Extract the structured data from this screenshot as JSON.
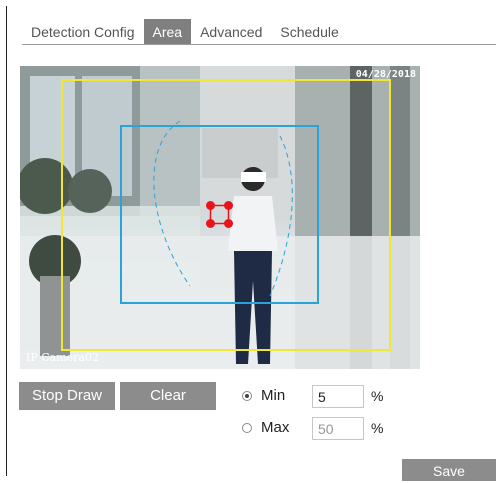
{
  "tabs": [
    {
      "label": "Detection Config",
      "active": false
    },
    {
      "label": "Area",
      "active": true
    },
    {
      "label": "Advanced",
      "active": false
    },
    {
      "label": "Schedule",
      "active": false
    }
  ],
  "video": {
    "timestamp": "04/28/2018",
    "camera_name": "IP Camera02"
  },
  "buttons": {
    "stop_draw": "Stop Draw",
    "clear": "Clear",
    "save": "Save"
  },
  "size": {
    "min_label": "Min",
    "min_value": "5",
    "min_unit": "%",
    "max_label": "Max",
    "max_value": "50",
    "max_unit": "%",
    "selected": "Min"
  },
  "colors": {
    "active_tab": "#7f7f7f",
    "button": "#8c8c8c",
    "detection_area_outline": "#f1e634",
    "target_outline": "#2aa3d8",
    "handle": "#e8141c"
  }
}
